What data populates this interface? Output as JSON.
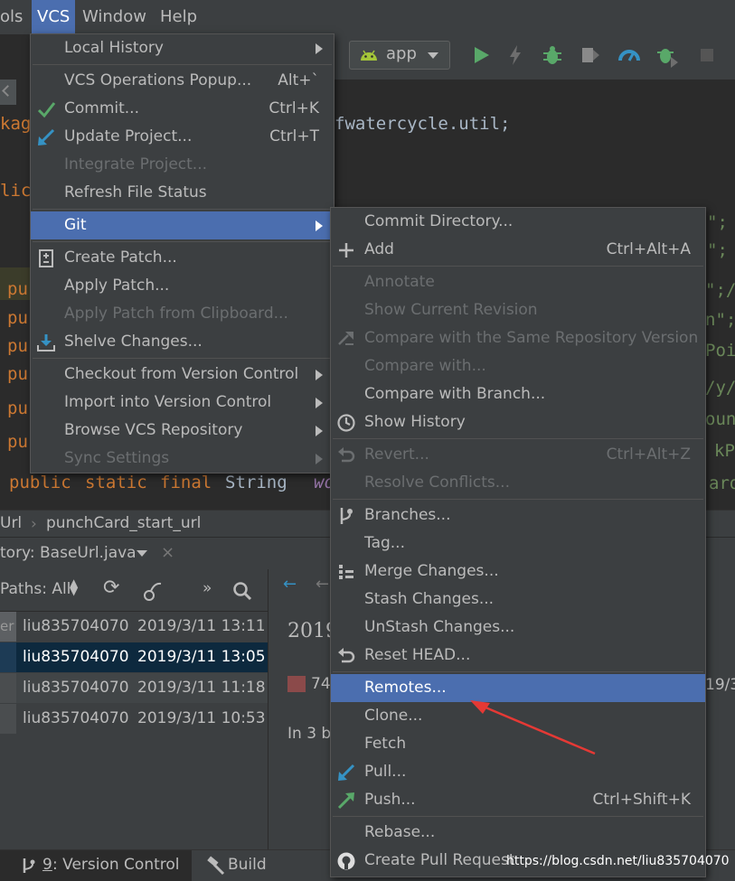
{
  "menubar": {
    "items": [
      "ols",
      "VCS",
      "Window",
      "Help"
    ]
  },
  "toolbar": {
    "run_config": "app"
  },
  "editor": {
    "lines": [
      {
        "prefix": "kag",
        "suffix": "fwatercycle.util;"
      },
      {
        "prefix": "lic",
        "suffix": ""
      }
    ],
    "pu_rows": [
      "pu",
      "pu",
      "pu",
      "pu",
      "pu",
      "pu"
    ],
    "right_fragments": [
      "\";",
      "\";",
      "\";/",
      "n\";",
      "Poi",
      "/y/",
      "oun",
      "kP",
      "ard"
    ],
    "last_line": {
      "kw1": "public",
      "kw2": "static",
      "kw3": "final",
      "type": "String",
      "var": "wo"
    }
  },
  "breadcrumb": {
    "items": [
      "Url",
      "punchCard_start_url"
    ]
  },
  "tool_window": {
    "title": "tory: BaseUrl.java"
  },
  "vc_log": {
    "paths_label": "Paths: All",
    "rows": [
      {
        "col0": "er",
        "author": "liu835704070",
        "date": "2019/3/11 13:11"
      },
      {
        "col0": "",
        "author": "liu835704070",
        "date": "2019/3/11 13:05"
      },
      {
        "col0": "",
        "author": "liu835704070",
        "date": "2019/3/11 11:18"
      },
      {
        "col0": "",
        "author": "liu835704070",
        "date": "2019/3/11 10:53"
      }
    ],
    "detail_year": "2019",
    "detail_num": "74",
    "detail_text": "In 3 b",
    "detail_right": "19/3"
  },
  "bottom_bar": {
    "vc_prefix": "9",
    "vc_label": ": Version Control",
    "build": "Build"
  },
  "watermark": "https://blog.csdn.net/liu835704070",
  "vcs_menu": [
    {
      "label": "Local History",
      "submenu": true
    },
    {
      "label": "VCS Operations Popup...",
      "shortcut": "Alt+`"
    },
    {
      "label": "Commit...",
      "shortcut": "Ctrl+K",
      "icon": "check-icon"
    },
    {
      "label": "Update Project...",
      "shortcut": "Ctrl+T",
      "icon": "update-arrow-icon"
    },
    {
      "label": "Integrate Project...",
      "disabled": true
    },
    {
      "label": "Refresh File Status"
    },
    {
      "label": "Git",
      "submenu": true,
      "selected": true
    },
    {
      "label": "Create Patch...",
      "icon": "patch-icon"
    },
    {
      "label": "Apply Patch..."
    },
    {
      "label": "Apply Patch from Clipboard...",
      "disabled": true
    },
    {
      "label": "Shelve Changes...",
      "icon": "shelve-icon"
    },
    {
      "label": "Checkout from Version Control",
      "submenu": true
    },
    {
      "label": "Import into Version Control",
      "submenu": true
    },
    {
      "label": "Browse VCS Repository",
      "submenu": true
    },
    {
      "label": "Sync Settings",
      "submenu": true,
      "disabled": true
    }
  ],
  "git_menu": [
    {
      "label": "Commit Directory..."
    },
    {
      "label": "Add",
      "shortcut": "Ctrl+Alt+A",
      "icon": "plus-icon"
    },
    {
      "label": "Annotate",
      "disabled": true
    },
    {
      "label": "Show Current Revision",
      "disabled": true
    },
    {
      "label": "Compare with the Same Repository Version",
      "disabled": true,
      "icon": "compare-arrows-icon"
    },
    {
      "label": "Compare with...",
      "disabled": true
    },
    {
      "label": "Compare with Branch..."
    },
    {
      "label": "Show History",
      "icon": "clock-icon"
    },
    {
      "label": "Revert...",
      "shortcut": "Ctrl+Alt+Z",
      "disabled": true,
      "icon": "revert-icon"
    },
    {
      "label": "Resolve Conflicts...",
      "disabled": true
    },
    {
      "label": "Branches...",
      "icon": "branch-icon"
    },
    {
      "label": "Tag..."
    },
    {
      "label": "Merge Changes...",
      "icon": "merge-icon"
    },
    {
      "label": "Stash Changes..."
    },
    {
      "label": "UnStash Changes..."
    },
    {
      "label": "Reset HEAD...",
      "icon": "reset-icon"
    },
    {
      "label": "Remotes...",
      "selected": true
    },
    {
      "label": "Clone..."
    },
    {
      "label": "Fetch"
    },
    {
      "label": "Pull...",
      "icon": "pull-icon"
    },
    {
      "label": "Push...",
      "shortcut": "Ctrl+Shift+K",
      "icon": "push-icon"
    },
    {
      "label": "Rebase..."
    },
    {
      "label": "Create Pull Request",
      "icon": "github-icon"
    }
  ],
  "colors": {
    "menu_bg": "#3c3f41",
    "selection": "#4b6eaf",
    "editor_bg": "#2b2b2b",
    "keyword": "#cc7832",
    "annotation_arrow": "#e53935"
  }
}
